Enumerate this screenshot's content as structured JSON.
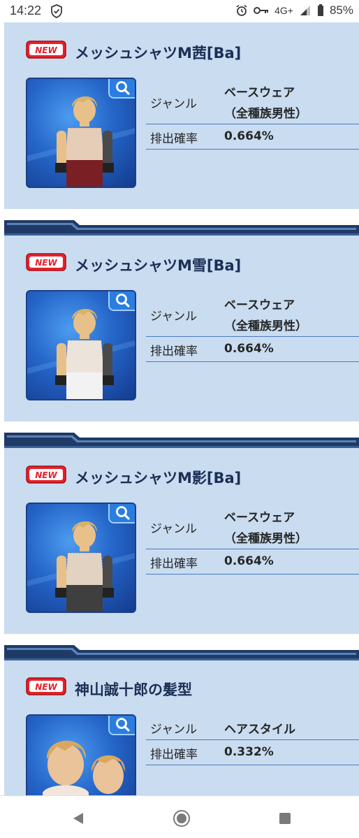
{
  "status_bar": {
    "time": "14:22",
    "network": "4G+",
    "battery": "85%"
  },
  "badge_text": "NEW",
  "labels": {
    "genre": "ジャンル",
    "rate": "排出確率"
  },
  "items": [
    {
      "title": "メッシュシャツM茜[Ba]",
      "genre_line1": "ベースウェア",
      "genre_line2": "（全種族男性）",
      "rate": "0.664%"
    },
    {
      "title": "メッシュシャツM雪[Ba]",
      "genre_line1": "ベースウェア",
      "genre_line2": "（全種族男性）",
      "rate": "0.664%"
    },
    {
      "title": "メッシュシャツM影[Ba]",
      "genre_line1": "ベースウェア",
      "genre_line2": "（全種族男性）",
      "rate": "0.664%"
    },
    {
      "title": "神山誠十郎の髪型",
      "genre_line1": "ヘアスタイル",
      "rate": "0.332%"
    }
  ],
  "colors": {
    "card_bg": "#c9dcf0",
    "title": "#1c2f55",
    "divider": "#4a7ac0",
    "badge_red": "#e8202a"
  }
}
